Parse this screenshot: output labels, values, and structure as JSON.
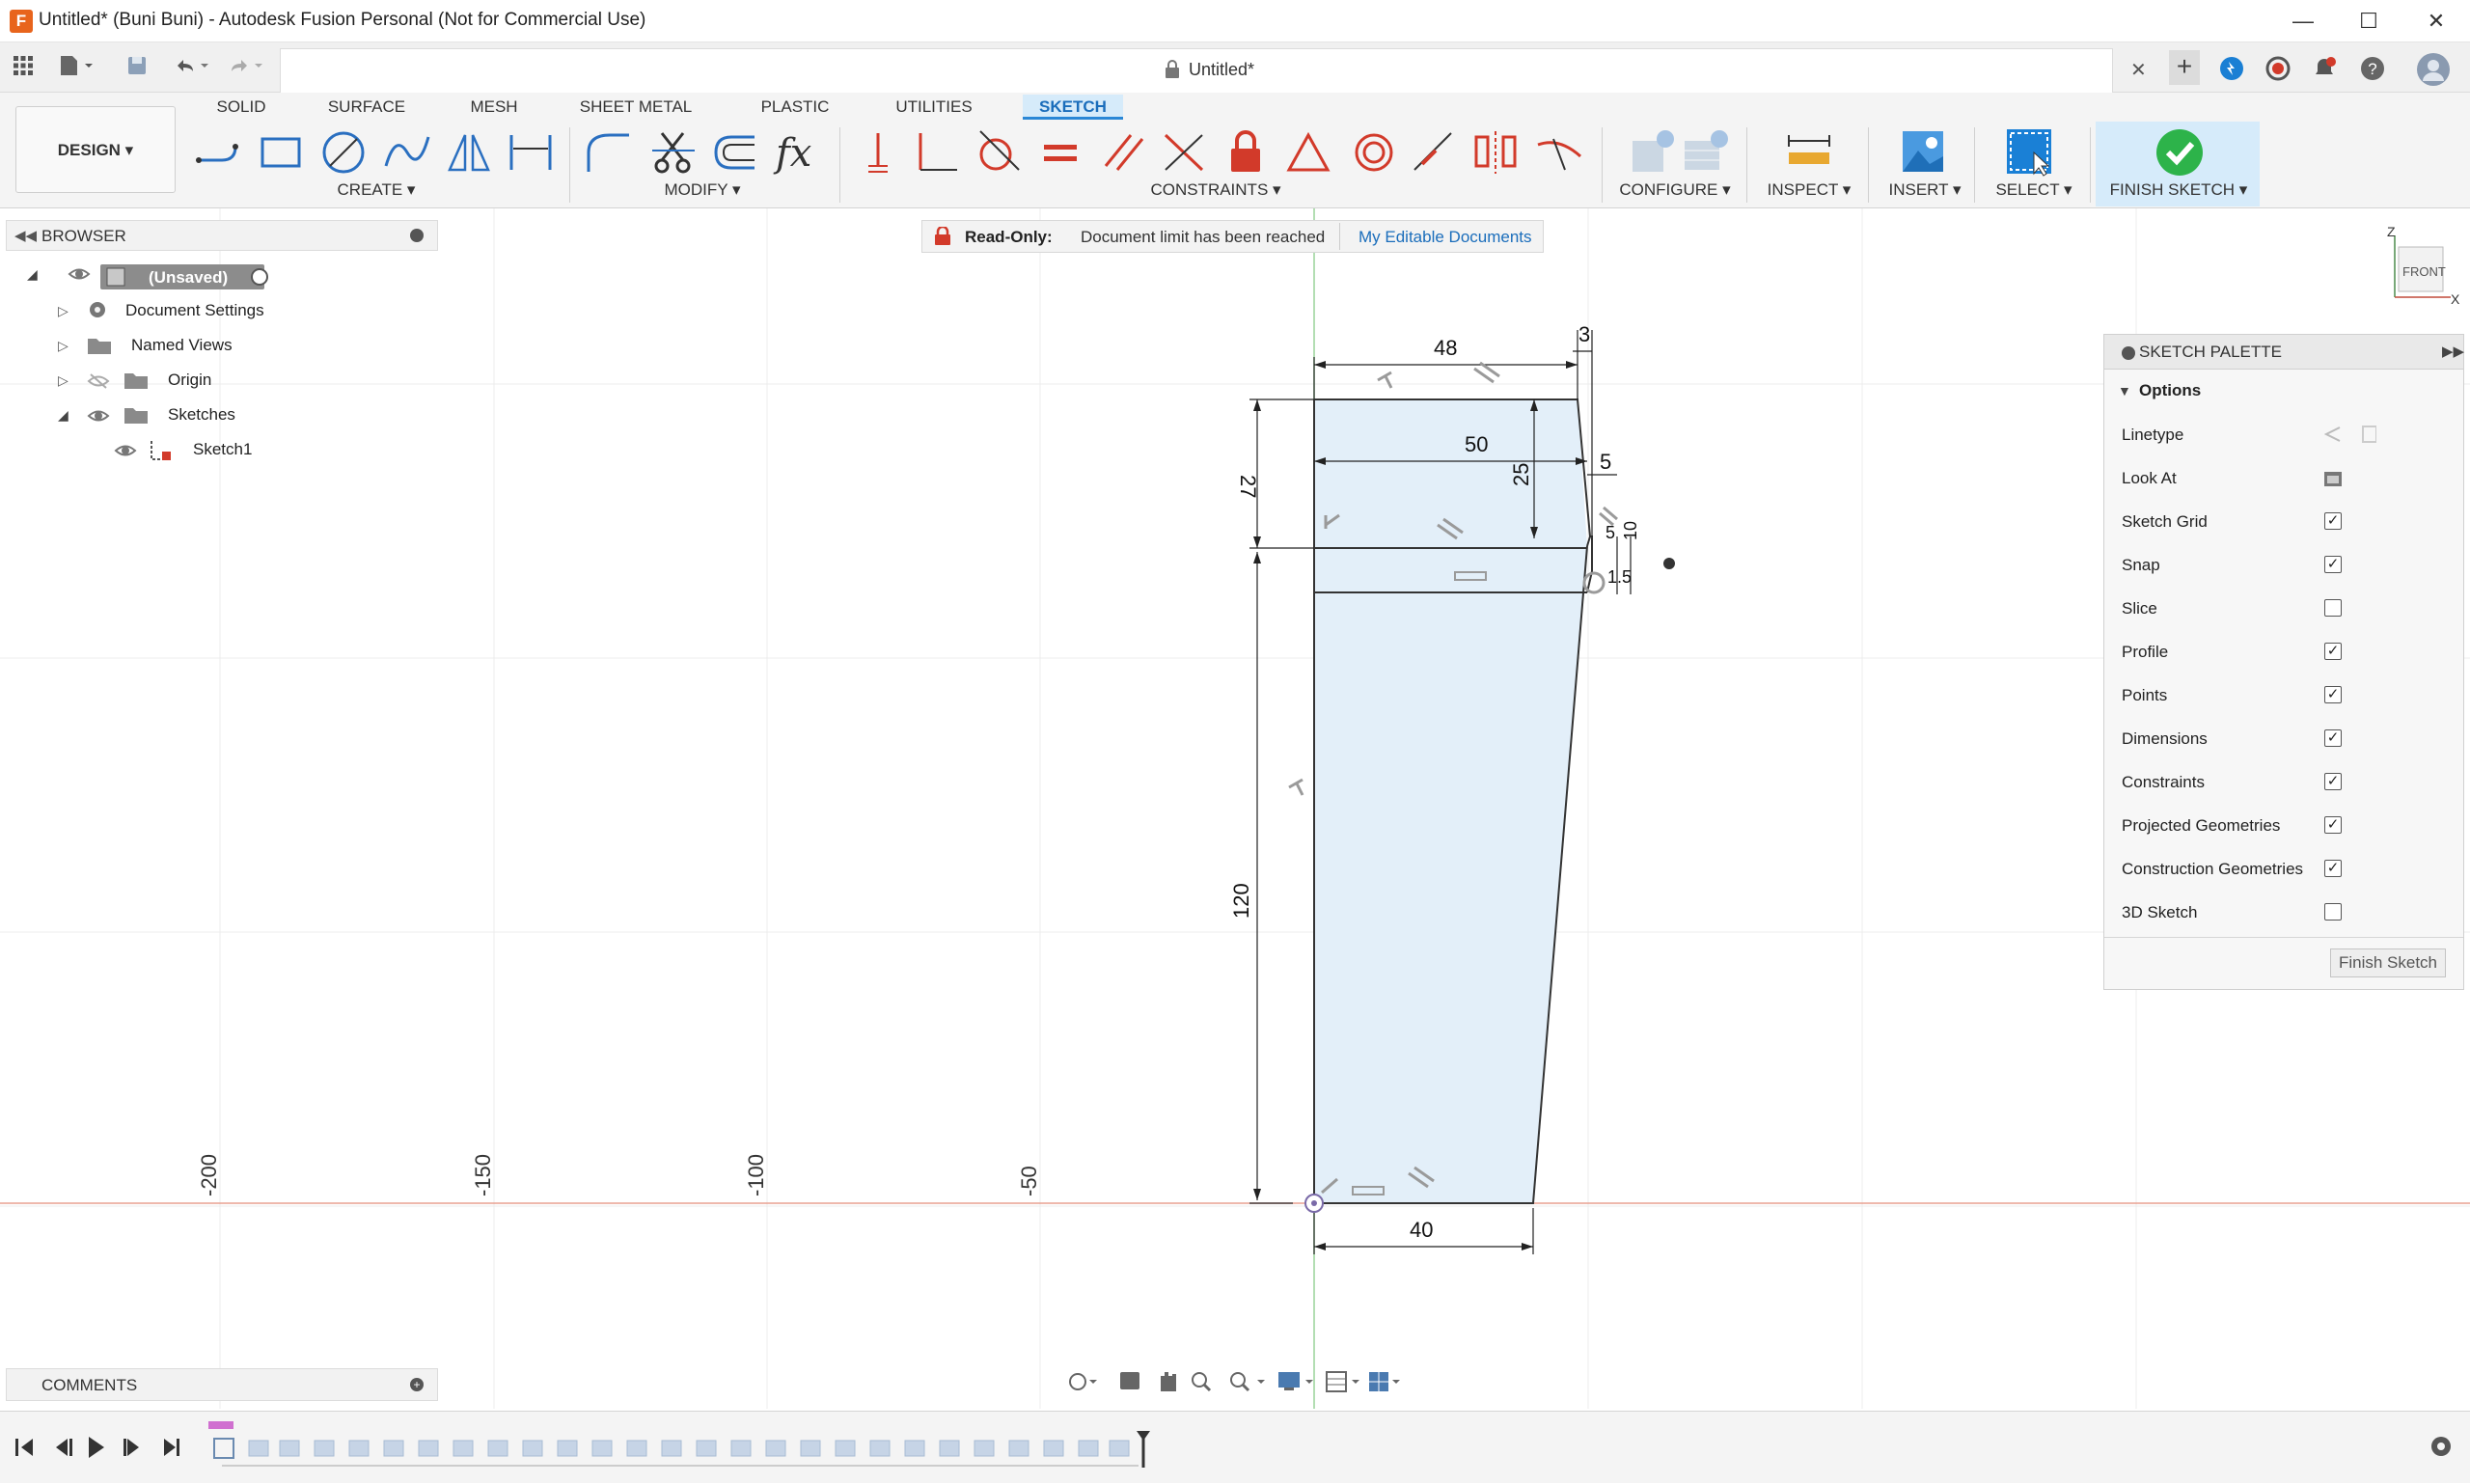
{
  "window": {
    "title": "Untitled* (Buni Buni) - Autodesk Fusion Personal (Not for Commercial Use)",
    "app_icon": "F",
    "minimize": "—",
    "maximize": "☐",
    "close": "✕"
  },
  "quick_access": {
    "doc_tab_title": "Untitled*",
    "doc_tab_close": "✕",
    "new_tab": "+"
  },
  "workspace": {
    "label": "DESIGN ▾"
  },
  "tabs": [
    "SOLID",
    "SURFACE",
    "MESH",
    "SHEET METAL",
    "PLASTIC",
    "UTILITIES",
    "SKETCH"
  ],
  "active_tab": "SKETCH",
  "groups": {
    "create": "CREATE ▾",
    "modify": "MODIFY ▾",
    "constraints": "CONSTRAINTS ▾",
    "configure": "CONFIGURE ▾",
    "inspect": "INSPECT ▾",
    "insert": "INSERT ▾",
    "select": "SELECT ▾",
    "finish": "FINISH SKETCH ▾"
  },
  "browser": {
    "title": "BROWSER",
    "root": "(Unsaved)",
    "items": [
      "Document Settings",
      "Named Views",
      "Origin",
      "Sketches",
      "Sketch1"
    ]
  },
  "banner": {
    "label": "Read-Only:",
    "message": "Document limit has been reached",
    "link": "My Editable Documents"
  },
  "viewcube": {
    "face": "FRONT",
    "axis_z": "Z",
    "axis_x": "X"
  },
  "palette": {
    "title": "SKETCH PALETTE",
    "section": "Options",
    "rows": [
      {
        "label": "Linetype",
        "kind": "icon"
      },
      {
        "label": "Look At",
        "kind": "icon"
      },
      {
        "label": "Sketch Grid",
        "checked": true
      },
      {
        "label": "Snap",
        "checked": true
      },
      {
        "label": "Slice",
        "checked": false
      },
      {
        "label": "Profile",
        "checked": true
      },
      {
        "label": "Points",
        "checked": true
      },
      {
        "label": "Dimensions",
        "checked": true
      },
      {
        "label": "Constraints",
        "checked": true
      },
      {
        "label": "Projected Geometries",
        "checked": true
      },
      {
        "label": "Construction Geometries",
        "checked": true
      },
      {
        "label": "3D Sketch",
        "checked": false
      }
    ],
    "finish_button": "Finish Sketch"
  },
  "grid_ticks": [
    "-200",
    "-150",
    "-100",
    "-50"
  ],
  "dimensions": {
    "top_width": "48",
    "top_offset": "3",
    "left_height_top": "27",
    "mid_width": "50",
    "mid_height": "25",
    "step": "5",
    "small_5": "5",
    "small_10": "10",
    "small_15": "1.5",
    "left_height_main": "120",
    "bottom_width": "40"
  },
  "comments": {
    "title": "COMMENTS"
  },
  "colors": {
    "accent": "#2a87d6",
    "finish_green": "#2db34a",
    "constraint_red": "#d23a2a",
    "profile_fill": "#e3eff9",
    "x_axis": "#e8a090",
    "y_axis": "#9ad39a"
  }
}
